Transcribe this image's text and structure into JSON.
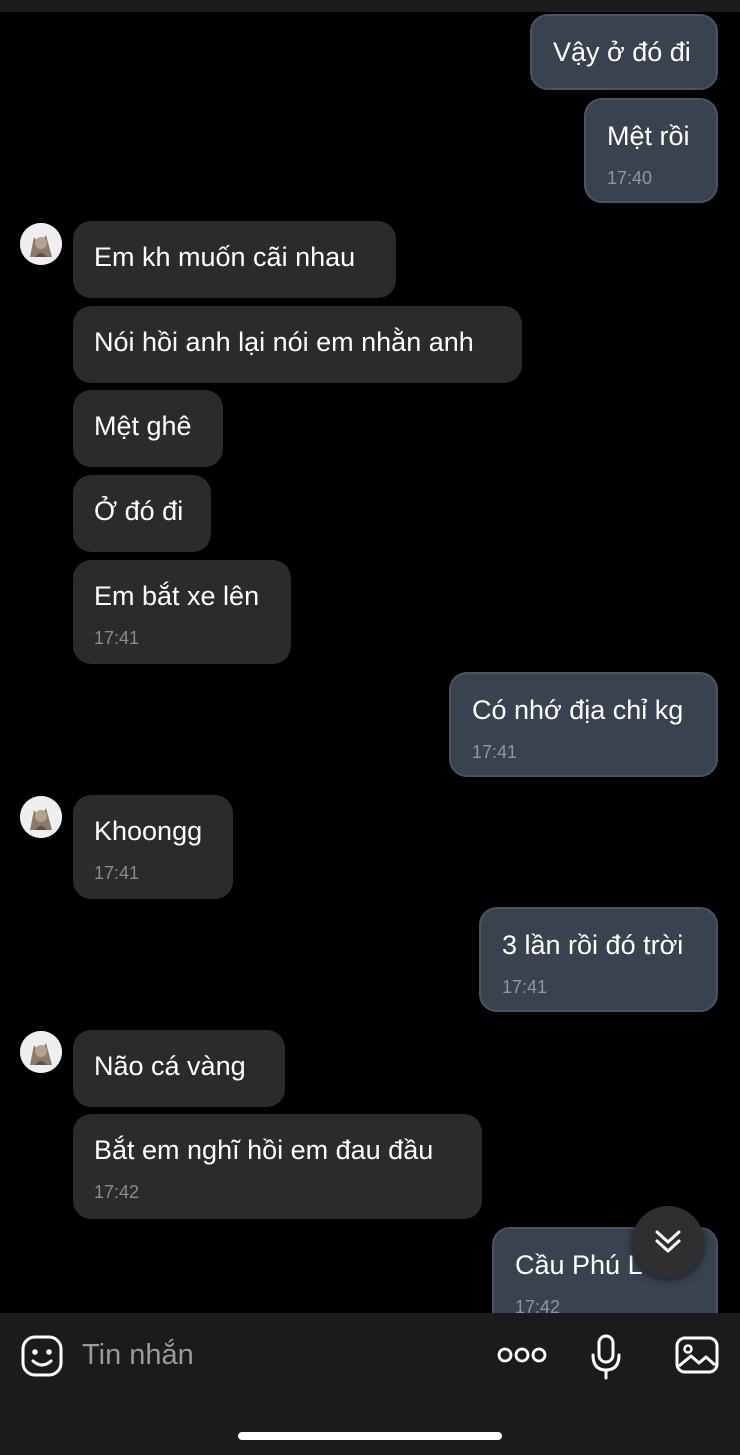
{
  "messages": [
    {
      "side": "me",
      "text": "Vậy ở đó đi"
    },
    {
      "side": "me",
      "text": "Mệt rồi",
      "time": "17:40"
    },
    {
      "side": "them",
      "text": "Em kh muốn cãi nhau"
    },
    {
      "side": "them",
      "text": "Nói hồi anh lại nói em nhằn anh"
    },
    {
      "side": "them",
      "text": "Mệt ghê"
    },
    {
      "side": "them",
      "text": "Ở đó đi"
    },
    {
      "side": "them",
      "text": "Em bắt xe lên",
      "time": "17:41"
    },
    {
      "side": "me",
      "text": "Có nhớ địa chỉ kg",
      "time": "17:41"
    },
    {
      "side": "them",
      "text": "Khoongg",
      "time": "17:41"
    },
    {
      "side": "me",
      "text": "3 lần rồi đó trời",
      "time": "17:41"
    },
    {
      "side": "them",
      "text": "Não cá vàng"
    },
    {
      "side": "them",
      "text": "Bắt em nghĩ hồi em đau đầu",
      "time": "17:42"
    },
    {
      "side": "me",
      "text": "Cầu Phú L",
      "time": "17:42"
    }
  ],
  "composer": {
    "placeholder": "Tin nhắn"
  },
  "icons": {
    "emoji": "emoji-icon",
    "more": "more-dots-icon",
    "mic": "microphone-icon",
    "gallery": "gallery-icon",
    "scroll": "scroll-down-icon",
    "avatar": "contact-avatar"
  },
  "colors": {
    "outgoing_bubble": "#3a4250",
    "incoming_bubble": "#2b2b2d",
    "background": "#000000"
  }
}
